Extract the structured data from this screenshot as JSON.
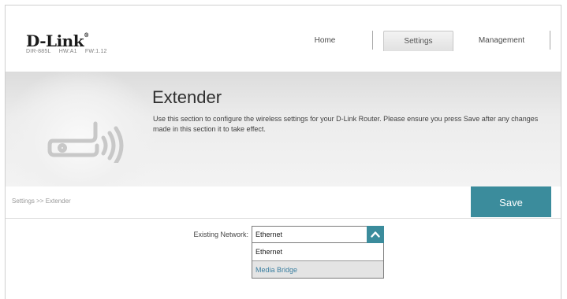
{
  "header": {
    "logo_text": "D-Link",
    "logo_mark": "®",
    "model": "DIR-885L",
    "hw": "HW:A1",
    "fw": "FW:1.12"
  },
  "nav": {
    "home": "Home",
    "settings": "Settings",
    "management": "Management"
  },
  "page": {
    "title": "Extender",
    "description": "Use this section to configure the wireless settings for your D-Link Router. Please ensure you press Save after any changes made in this section it to take effect.",
    "icon": "router-wireless-icon"
  },
  "breadcrumb": "Settings >> Extender",
  "save_label": "Save",
  "form": {
    "existing_network_label": "Existing Network:",
    "existing_network_value": "Ethernet",
    "options": [
      "Ethernet",
      "Media Bridge"
    ]
  },
  "colors": {
    "accent": "#3b8c9c",
    "hover_text": "#3b7fa0"
  }
}
